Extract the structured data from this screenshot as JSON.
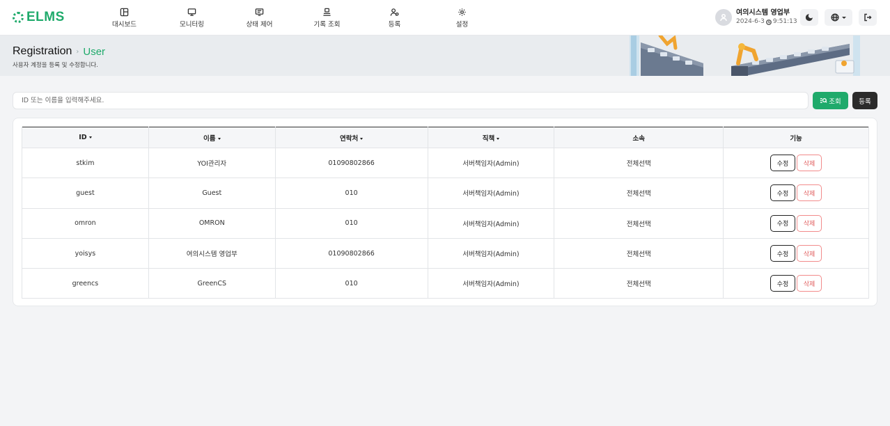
{
  "header": {
    "logo": "ELMS",
    "nav": [
      {
        "label": "대시보드",
        "icon": "layout-icon"
      },
      {
        "label": "모니터링",
        "icon": "monitor-icon"
      },
      {
        "label": "상태 제어",
        "icon": "control-panel-icon"
      },
      {
        "label": "기록 조회",
        "icon": "records-icon"
      },
      {
        "label": "등록",
        "icon": "user-register-icon"
      },
      {
        "label": "설정",
        "icon": "gear-icon"
      }
    ],
    "user": {
      "name": "여의시스템 영업부",
      "date": "2024-6-3",
      "time": "9:51:13"
    }
  },
  "banner": {
    "title": "Registration",
    "subtitle": "User",
    "description": "사용자 계정을 등록 및 수정합니다."
  },
  "search": {
    "placeholder": "ID 또는 이름을 입력해주세요.",
    "value": "",
    "search_label": "조회",
    "register_label": "등록"
  },
  "table": {
    "columns": [
      "ID",
      "이름",
      "연락처",
      "직책",
      "소속",
      "기능"
    ],
    "edit_label": "수정",
    "delete_label": "삭제",
    "rows": [
      {
        "id": "stkim",
        "name": "YOI관리자",
        "phone": "01090802866",
        "role": "서버책임자(Admin)",
        "org": "전체선택"
      },
      {
        "id": "guest",
        "name": "Guest",
        "phone": "010",
        "role": "서버책임자(Admin)",
        "org": "전체선택"
      },
      {
        "id": "omron",
        "name": "OMRON",
        "phone": "010",
        "role": "서버책임자(Admin)",
        "org": "전체선택"
      },
      {
        "id": "yoisys",
        "name": "여의시스템 영업부",
        "phone": "01090802866",
        "role": "서버책임자(Admin)",
        "org": "전체선택"
      },
      {
        "id": "greencs",
        "name": "GreenCS",
        "phone": "010",
        "role": "서버책임자(Admin)",
        "org": "전체선택"
      }
    ]
  },
  "colors": {
    "accent": "#1faa6b",
    "dark": "#2b2b2b",
    "danger": "#e05b5b"
  }
}
